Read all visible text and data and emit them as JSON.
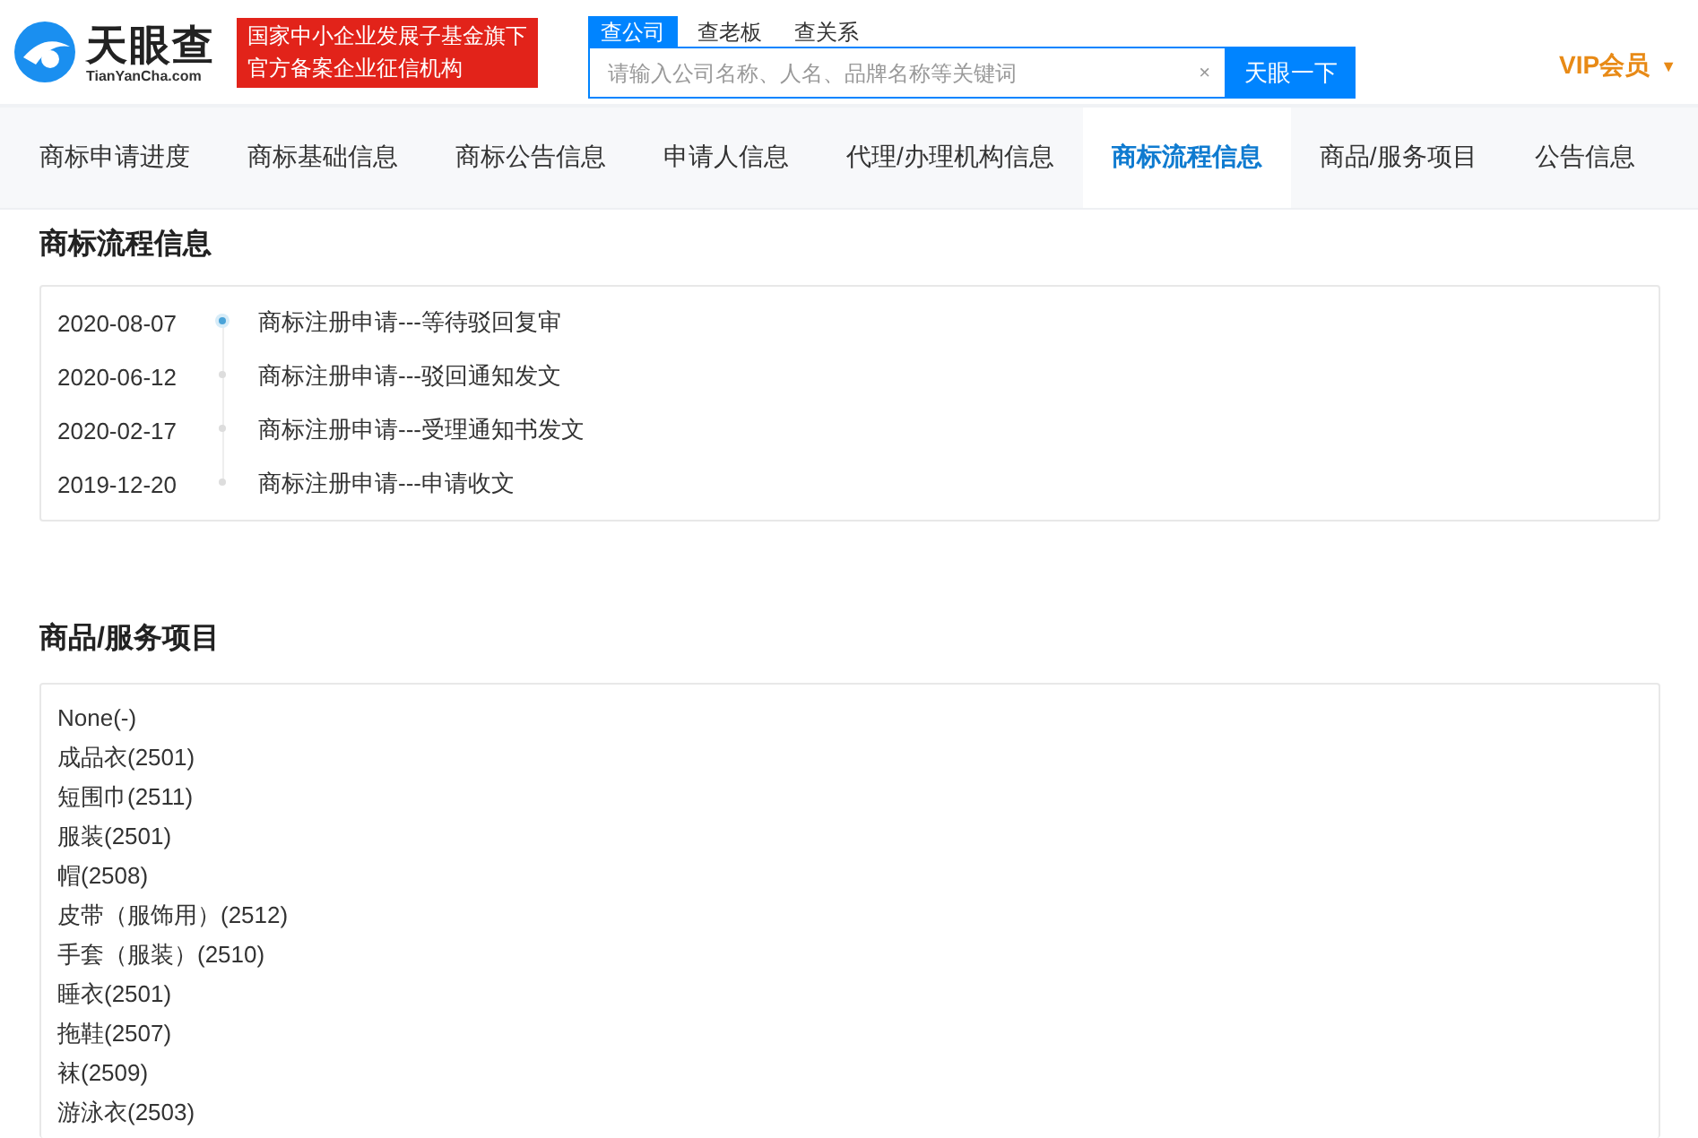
{
  "header": {
    "logo": {
      "name": "天眼查",
      "domain": "TianYanCha.com"
    },
    "badge": [
      "国家中小企业发展子基金旗下",
      "官方备案企业征信机构"
    ],
    "search": {
      "tabs": [
        {
          "label": "查公司",
          "selected": true
        },
        {
          "label": "查老板",
          "selected": false
        },
        {
          "label": "查关系",
          "selected": false
        }
      ],
      "placeholder": "请输入公司名称、人名、品牌名称等关键词",
      "clear": "×",
      "button": "天眼一下"
    },
    "vip": {
      "label": "VIP会员",
      "caret": "▼"
    }
  },
  "tabs": [
    {
      "label": "商标申请进度",
      "selected": false
    },
    {
      "label": "商标基础信息",
      "selected": false
    },
    {
      "label": "商标公告信息",
      "selected": false
    },
    {
      "label": "申请人信息",
      "selected": false
    },
    {
      "label": "代理/办理机构信息",
      "selected": false
    },
    {
      "label": "商标流程信息",
      "selected": true
    },
    {
      "label": "商品/服务项目",
      "selected": false
    },
    {
      "label": "公告信息",
      "selected": false
    }
  ],
  "flow": {
    "title": "商标流程信息",
    "events": [
      {
        "date": "2020-08-07",
        "text": "商标注册申请---等待驳回复审",
        "active": true
      },
      {
        "date": "2020-06-12",
        "text": "商标注册申请---驳回通知发文",
        "active": false
      },
      {
        "date": "2020-02-17",
        "text": "商标注册申请---受理通知书发文",
        "active": false
      },
      {
        "date": "2019-12-20",
        "text": "商标注册申请---申请收文",
        "active": false
      }
    ]
  },
  "goods": {
    "title": "商品/服务项目",
    "items": [
      "None(-)",
      "成品衣(2501)",
      "短围巾(2511)",
      "服装(2501)",
      "帽(2508)",
      "皮带（服饰用）(2512)",
      "手套（服装）(2510)",
      "睡衣(2501)",
      "拖鞋(2507)",
      "袜(2509)",
      "游泳衣(2503)"
    ]
  }
}
